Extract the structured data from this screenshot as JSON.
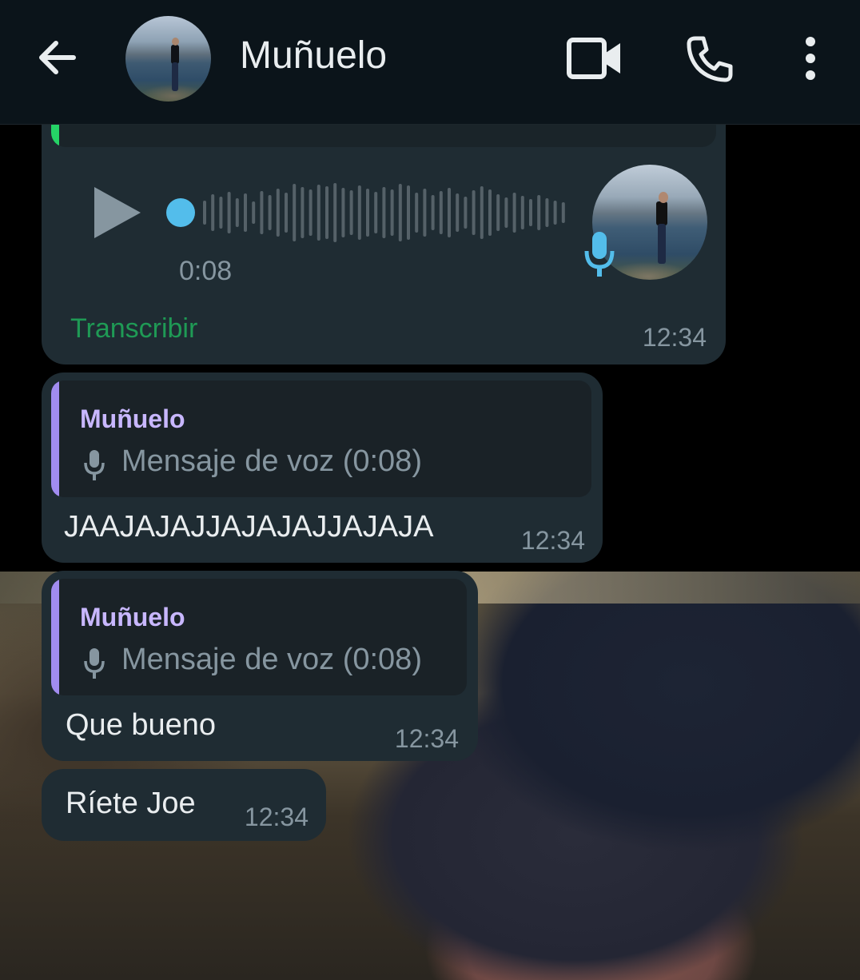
{
  "header": {
    "contact_name": "Muñuelo",
    "icons": [
      "back-arrow-icon",
      "contact-avatar",
      "video-call-icon",
      "phone-call-icon",
      "more-vert-icon"
    ]
  },
  "voice_message": {
    "duration": "0:08",
    "transcribe_label": "Transcribir",
    "time": "12:34",
    "accent_color": "#25d366",
    "progress": 0
  },
  "messages": [
    {
      "quote_sender": "Muñuelo",
      "quote_text": "Mensaje de voz (0:08)",
      "text": "JAAJAJAJJAJAJAJJAJAJA",
      "time": "12:34"
    },
    {
      "quote_sender": "Muñuelo",
      "quote_text": "Mensaje de voz (0:08)",
      "text": "Que bueno",
      "time": "12:34"
    },
    {
      "text": "Ríete Joe",
      "time": "12:34"
    }
  ],
  "colors": {
    "header_bg": "#0b141a",
    "bubble_bg": "#1f2c33",
    "quote_accent": "#a18cf0",
    "quote_name": "#c8b7ff",
    "link_green": "#1f9a55",
    "wave_dot": "#53bdeb"
  }
}
